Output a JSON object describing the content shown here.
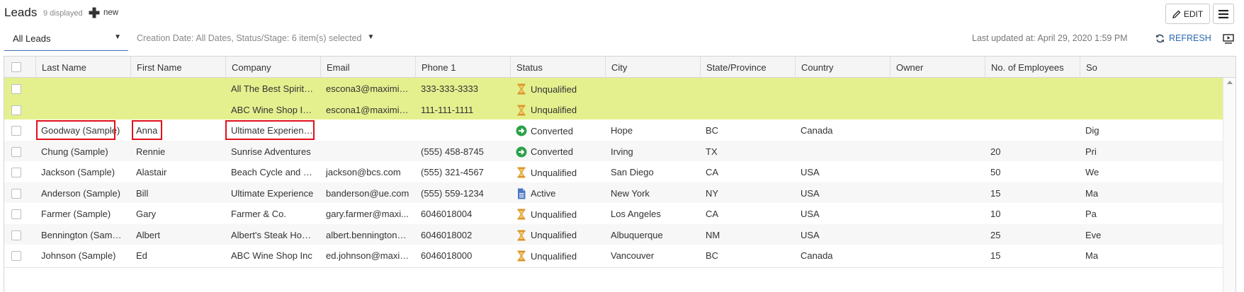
{
  "header": {
    "title": "Leads",
    "count": "9 displayed",
    "new_label": "new",
    "edit_label": "EDIT"
  },
  "toolbar": {
    "view": "All Leads",
    "filter": "Creation Date: All Dates, Status/Stage: 6 item(s) selected",
    "updated": "Last updated at: April 29, 2020 1:59 PM",
    "refresh_label": "REFRESH"
  },
  "colors": {
    "accent": "#2a6aaf",
    "selected_row": "#e4f08e",
    "highlight": "#e0101a",
    "unqualified": "#e0a22b",
    "converted": "#2aa14a",
    "active": "#4a78c0"
  },
  "columns": [
    "Last Name",
    "First Name",
    "Company",
    "Email",
    "Phone 1",
    "Status",
    "City",
    "State/Province",
    "Country",
    "Owner",
    "No. of Employees",
    "So"
  ],
  "rows": [
    {
      "last": "",
      "first": "",
      "company": "All The Best Spirits ...",
      "email": "escona3@maximiz...",
      "phone": "333-333-3333",
      "status": "Unqualified",
      "status_icon": "hourglass-icon",
      "city": "",
      "state": "",
      "country": "",
      "owner": "",
      "employees": "",
      "source": ""
    },
    {
      "last": "",
      "first": "",
      "company": "ABC Wine Shop Inc....",
      "email": "escona1@maximiz...",
      "phone": "111-111-1111",
      "status": "Unqualified",
      "status_icon": "hourglass-icon",
      "city": "",
      "state": "",
      "country": "",
      "owner": "",
      "employees": "",
      "source": ""
    },
    {
      "last": "Goodway (Sample)",
      "first": "Anna",
      "company": "Ultimate Experience.",
      "email": "",
      "phone": "",
      "status": "Converted",
      "status_icon": "arrow-circle-icon",
      "city": "Hope",
      "state": "BC",
      "country": "Canada",
      "owner": "",
      "employees": "",
      "source": "Dig"
    },
    {
      "last": "Chung (Sample)",
      "first": "Rennie",
      "company": "Sunrise Adventures",
      "email": "",
      "phone": "(555) 458-8745",
      "status": "Converted",
      "status_icon": "arrow-circle-icon",
      "city": "Irving",
      "state": "TX",
      "country": "",
      "owner": "",
      "employees": "20",
      "source": "Pri"
    },
    {
      "last": "Jackson (Sample)",
      "first": "Alastair",
      "company": "Beach Cycle and Sp...",
      "email": "jackson@bcs.com",
      "phone": "(555) 321-4567",
      "status": "Unqualified",
      "status_icon": "hourglass-icon",
      "city": "San Diego",
      "state": "CA",
      "country": "USA",
      "owner": "",
      "employees": "50",
      "source": "We"
    },
    {
      "last": "Anderson (Sample)",
      "first": "Bill",
      "company": "Ultimate Experience",
      "email": "banderson@ue.com",
      "phone": "(555) 559-1234",
      "status": "Active",
      "status_icon": "document-icon",
      "city": "New York",
      "state": "NY",
      "country": "USA",
      "owner": "",
      "employees": "15",
      "source": "Ma"
    },
    {
      "last": "Farmer (Sample)",
      "first": "Gary",
      "company": "Farmer & Co.",
      "email": "gary.farmer@maxi...",
      "phone": "6046018004",
      "status": "Unqualified",
      "status_icon": "hourglass-icon",
      "city": "Los Angeles",
      "state": "CA",
      "country": "USA",
      "owner": "",
      "employees": "10",
      "source": "Pa"
    },
    {
      "last": "Bennington (Sample)",
      "first": "Albert",
      "company": "Albert's Steak House",
      "email": "albert.bennington@...",
      "phone": "6046018002",
      "status": "Unqualified",
      "status_icon": "hourglass-icon",
      "city": "Albuquerque",
      "state": "NM",
      "country": "USA",
      "owner": "",
      "employees": "25",
      "source": "Eve"
    },
    {
      "last": "Johnson (Sample)",
      "first": "Ed",
      "company": "ABC Wine Shop Inc",
      "email": "ed.johnson@maxim...",
      "phone": "6046018000",
      "status": "Unqualified",
      "status_icon": "hourglass-icon",
      "city": "Vancouver",
      "state": "BC",
      "country": "Canada",
      "owner": "",
      "employees": "15",
      "source": "Ma"
    }
  ]
}
